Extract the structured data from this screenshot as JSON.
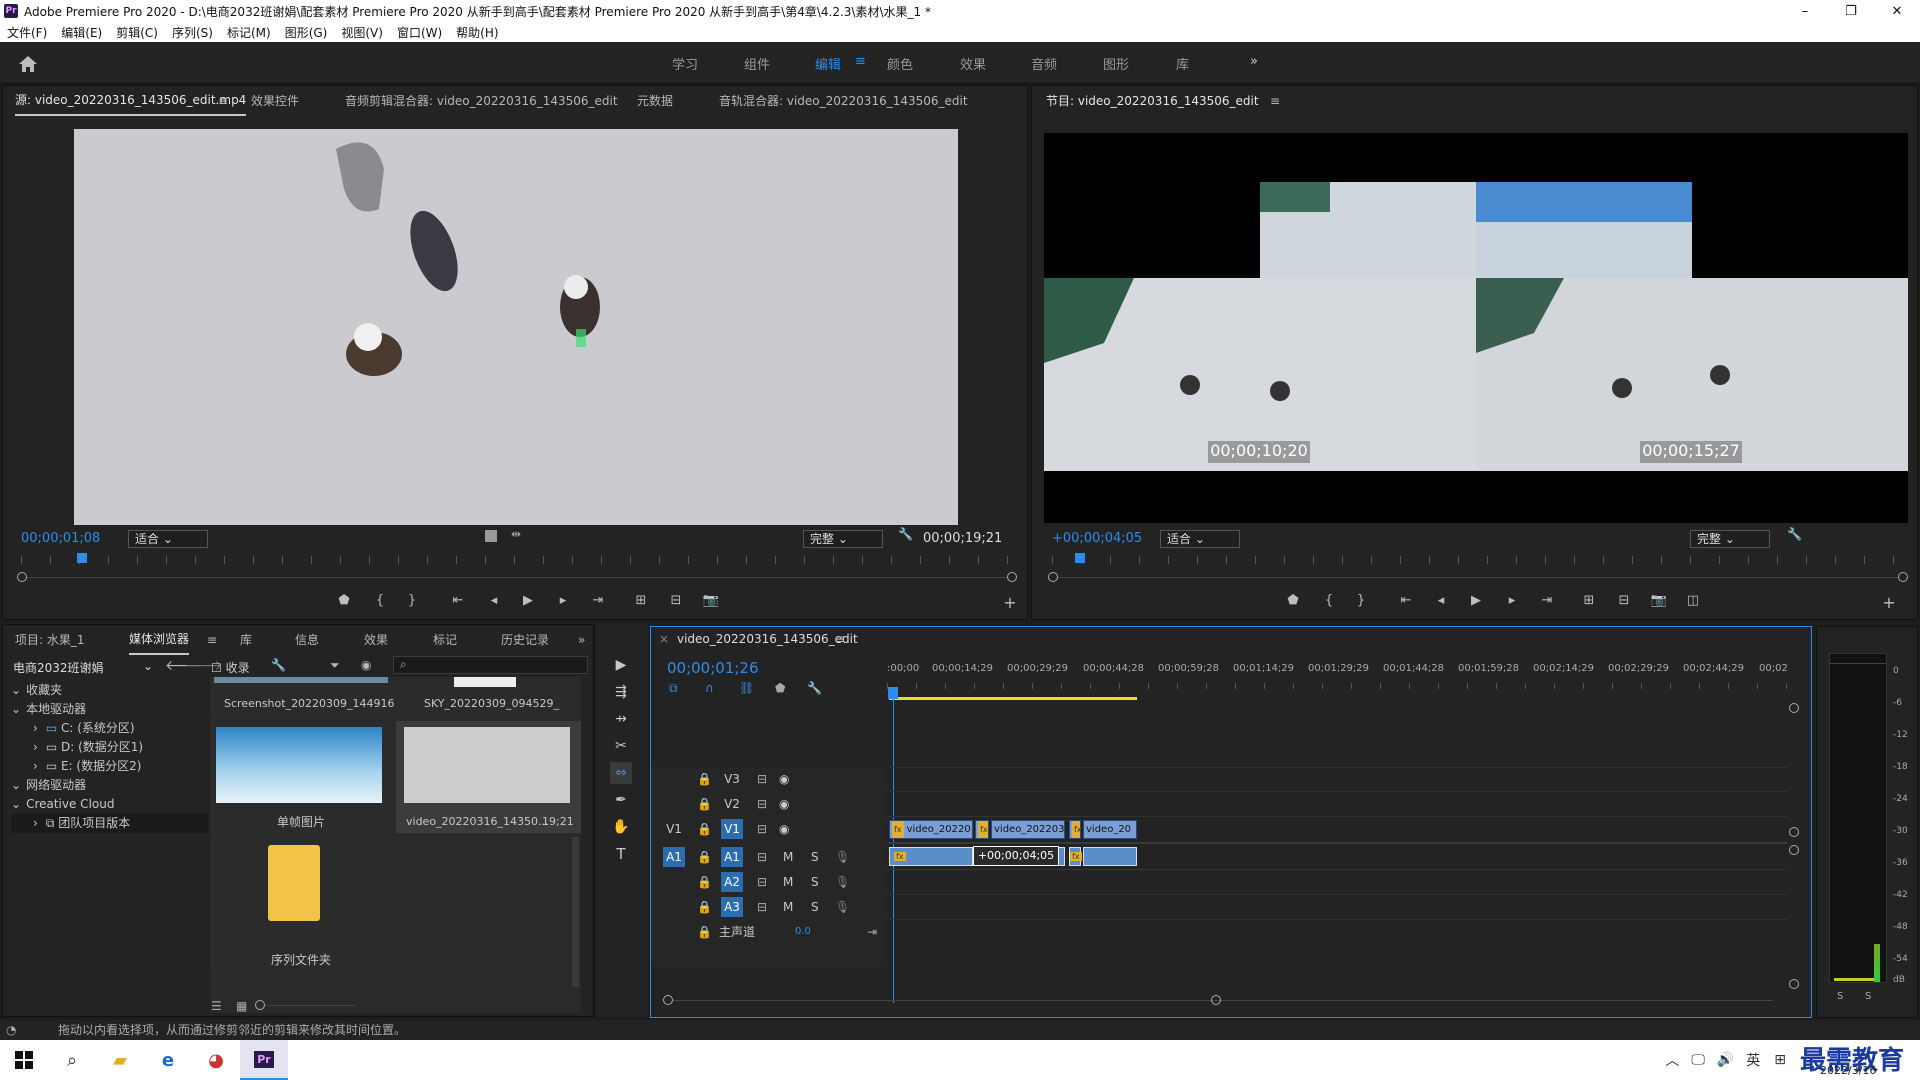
{
  "window": {
    "title": "Adobe Premiere Pro 2020 - D:\\电商2032班谢娟\\配套素材 Premiere Pro 2020 从新手到高手\\配套素材 Premiere Pro 2020 从新手到高手\\第4章\\4.2.3\\素材\\水果_1 *",
    "minimize": "–",
    "restore": "❐",
    "close": "✕"
  },
  "menu": [
    "文件(F)",
    "编辑(E)",
    "剪辑(C)",
    "序列(S)",
    "标记(M)",
    "图形(G)",
    "视图(V)",
    "窗口(W)",
    "帮助(H)"
  ],
  "workspaces": {
    "items": [
      "学习",
      "组件",
      "编辑",
      "颜色",
      "效果",
      "音频",
      "图形",
      "库"
    ],
    "active": "编辑",
    "more": "»",
    "menu": "≡"
  },
  "source": {
    "tabs": [
      "源: video_20220316_143506_edit.mp4",
      "效果控件",
      "音频剪辑混合器: video_20220316_143506_edit",
      "元数据",
      "音轨混合器: video_20220316_143506_edit"
    ],
    "tab_menu": "≡",
    "timecode": "00;00;01;08",
    "fit": "适合",
    "quality": "完整",
    "duration": "00;00;19;21"
  },
  "program": {
    "tab": "节目: video_20220316_143506_edit",
    "tab_menu": "≡",
    "timecode": "+00;00;04;05",
    "fit": "适合",
    "quality": "完整",
    "tc_left": "00;00;10;20",
    "tc_right": "00;00;15;27"
  },
  "project": {
    "tabs": [
      "项目: 水果_1",
      "媒体浏览器",
      "库",
      "信息",
      "效果",
      "标记",
      "历史记录"
    ],
    "active": "媒体浏览器",
    "tab_menu": "≡",
    "more": "»",
    "location": "电商2032班谢娟",
    "ingest": "收录",
    "search_icon": "⌕",
    "tree": [
      {
        "label": "收藏夹",
        "level": 0,
        "arrow": "⌄"
      },
      {
        "label": "本地驱动器",
        "level": 0,
        "arrow": "⌄"
      },
      {
        "label": "C: (系统分区)",
        "level": 1,
        "arrow": "›"
      },
      {
        "label": "D: (数据分区1)",
        "level": 1,
        "arrow": "›"
      },
      {
        "label": "E: (数据分区2)",
        "level": 1,
        "arrow": "›"
      },
      {
        "label": "网络驱动器",
        "level": 0,
        "arrow": "⌄"
      },
      {
        "label": "Creative Cloud",
        "level": 0,
        "arrow": "⌄"
      },
      {
        "label": "团队项目版本",
        "level": 1,
        "arrow": "›"
      }
    ],
    "items": [
      {
        "name": "Screenshot_20220309_144916"
      },
      {
        "name": "SKY_20220309_094529_"
      },
      {
        "name": "单帧图片"
      },
      {
        "name": "video_20220316_14350...",
        "duration": "19;21"
      },
      {
        "name": "序列文件夹"
      }
    ]
  },
  "timeline": {
    "tab": "video_20220316_143506_edit",
    "close": "×",
    "tab_menu": "≡",
    "timecode": "00;00;01;26",
    "ruler": [
      ":00;00",
      "00;00;14;29",
      "00;00;29;29",
      "00;00;44;28",
      "00;00;59;28",
      "00;01;14;29",
      "00;01;29;29",
      "00;01;44;28",
      "00;01;59;28",
      "00;02;14;29",
      "00;02;29;29",
      "00;02;44;29",
      "00;02"
    ],
    "video_tracks": [
      "V3",
      "V2",
      "V1"
    ],
    "audio_tracks": [
      "A1",
      "A2",
      "A3"
    ],
    "src_v": "V1",
    "src_a": "A1",
    "master_label": "主声道",
    "master_value": "0.0",
    "ms": [
      "M",
      "S"
    ],
    "clips": [
      "video_20220",
      "video_202203",
      "video_20"
    ],
    "fx": "fx",
    "offset": "+00;00;04;05"
  },
  "meter": {
    "labels": [
      "0",
      "-6",
      "-12",
      "-18",
      "-24",
      "-30",
      "-36",
      "-42",
      "-48",
      "-54",
      "dB"
    ],
    "solo": [
      "S",
      "S"
    ]
  },
  "status": "拖动以内看选择项，从而通过修剪邻近的剪辑来修改其时间位置。",
  "taskbar": {
    "ime": "英",
    "date": "2022/3/16",
    "watermark": "最需教育",
    "pr": "Pr"
  }
}
